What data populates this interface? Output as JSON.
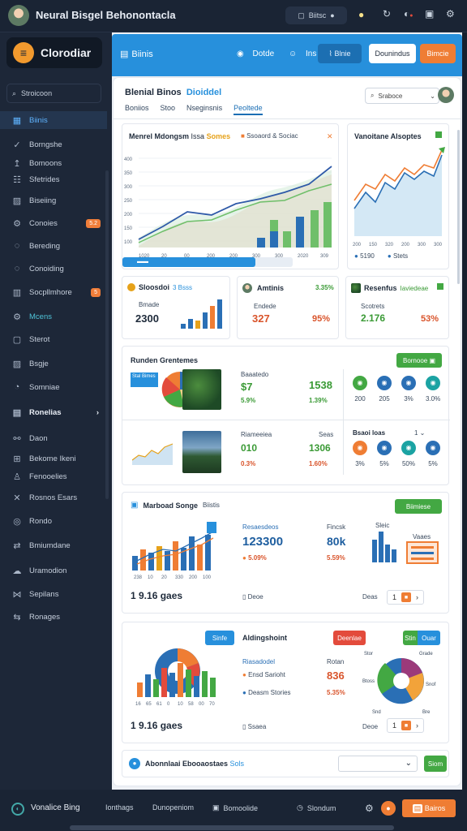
{
  "topbar": {
    "title": "Neural Bisgel Behonontacla",
    "button_label": "Biitsc"
  },
  "sidebar": {
    "brand": "Clorodiar",
    "search_placeholder": "Stroicoon",
    "items": [
      {
        "label": "Biinis",
        "icon": "grid-icon"
      },
      {
        "label": "Borngshe",
        "icon": "check-icon"
      },
      {
        "label": "Bomoons",
        "icon": "arrow-up-icon"
      },
      {
        "label": "Sfetrides",
        "icon": "sliders-icon"
      },
      {
        "label": "Biseiing",
        "icon": "image-icon"
      },
      {
        "label": "Conoies",
        "icon": "gear-icon",
        "badge": "5.2"
      },
      {
        "label": "Bereding",
        "icon": "chat-icon"
      },
      {
        "label": "Conoiding",
        "icon": "chat-icon"
      },
      {
        "label": "Socpllmhore",
        "icon": "bars-icon",
        "badge": "5"
      },
      {
        "label": "Mcens",
        "icon": "gear-icon"
      },
      {
        "label": "Sterot",
        "icon": "window-icon"
      },
      {
        "label": "Bsgje",
        "icon": "image-icon"
      },
      {
        "label": "Somniae",
        "icon": "pie-icon"
      }
    ],
    "section_label": "Ronelias",
    "section_items": [
      {
        "label": "Daon",
        "icon": "link-icon"
      },
      {
        "label": "Bekome Ikeni",
        "icon": "cart-icon"
      },
      {
        "label": "Fenooelies",
        "icon": "user-icon"
      },
      {
        "label": "Rosnos Esars",
        "icon": "tool-icon"
      },
      {
        "label": "Rondo",
        "icon": "target-icon"
      },
      {
        "label": "Bmiumdane",
        "icon": "route-icon"
      },
      {
        "label": "Uramodion",
        "icon": "cloud-icon"
      },
      {
        "label": "Sepilans",
        "icon": "handshake-icon"
      },
      {
        "label": "Ronages",
        "icon": "arrows-icon"
      }
    ]
  },
  "header": {
    "title": "Biinis",
    "nav": [
      {
        "label": "Dotde",
        "icon": "palette-icon"
      },
      {
        "label": "Ins",
        "icon": "smile-icon"
      },
      {
        "label": "Blnie",
        "icon": "chart-icon"
      }
    ],
    "btn_white": "Dounindus",
    "btn_orange": "Bimcie"
  },
  "toolbar": {
    "heading": "Blenial Binos",
    "heading_accent": "Dioiddel",
    "tabs": [
      "Boniios",
      "Stoo",
      "Nseginsnis",
      "Peoltede"
    ],
    "active_tab": 3,
    "search_placeholder": "Sraboce"
  },
  "main_chart": {
    "title": "Menrel Mdongsm",
    "meta": "Issa",
    "legend": "Somes",
    "legend2": "Ssoaord & Sociac",
    "y_ticks": [
      "400",
      "350",
      "300",
      "250",
      "200",
      "150",
      "100"
    ],
    "x_ticks": [
      "1020",
      "20",
      "00",
      "200",
      "200",
      "300",
      "300",
      "2020",
      "309"
    ],
    "progress": 0.78
  },
  "side_chart": {
    "title": "Vanoitane Alsoptes",
    "x_ticks": [
      "200",
      "150",
      "320",
      "200",
      "300",
      "300"
    ],
    "legend": [
      {
        "label": "5190"
      },
      {
        "label": "Stets"
      }
    ]
  },
  "kpis": [
    {
      "title": "Sloosdoi",
      "meta": "3 Bsss",
      "sub": "Bmade",
      "value": "2300"
    },
    {
      "title": "Amtinis",
      "change": "3.35%",
      "sub": "Endede",
      "value": "327",
      "value2": "95%"
    },
    {
      "title": "Resenfus",
      "meta": "Iaviedeae",
      "sub": "Scotrets",
      "value": "2.176",
      "value2": "53%"
    }
  ],
  "resource_panel": {
    "title": "Runden Grentemes",
    "btn": "Bornooe",
    "block1": {
      "label": "Baaatedo",
      "value": "$7",
      "change": "5.9%",
      "big": "1538",
      "big_change": "1.39%"
    },
    "block2": {
      "label": "Riameeiea",
      "meta": "Seas",
      "value": "010",
      "change": "0.3%",
      "big": "1306",
      "big_change": "1.60%"
    },
    "pie_tag": "Stal Bimes",
    "circles_top": [
      "200",
      "205",
      "3%",
      "3.0%"
    ],
    "circles_label": "Bsaoi loas",
    "circles_bottom": [
      "3%",
      "5%",
      "50%",
      "5%"
    ]
  },
  "monitor_panel": {
    "title": "Marboad Songe",
    "meta": "Biistis",
    "btn": "Biimiese",
    "label1": "Resaesdeos",
    "value1": "123300",
    "change1": "5.09%",
    "label2": "Fincsk",
    "value2": "80k",
    "change2": "5.59%",
    "bar_label": "Sleic",
    "card_label": "Vaaes",
    "x_ticks": [
      "238",
      "10",
      "20",
      "330",
      "200",
      "100"
    ],
    "footer_big": "1 9.16 gaes",
    "footer_small": "Deoe",
    "pager_label": "Deas",
    "page": "1"
  },
  "analysis_panel": {
    "title": "Aldingshoint",
    "btn_blue": "Sinfe",
    "btn_red": "Deenlae",
    "btn_dual": [
      "Stin",
      "Ouar"
    ],
    "label1": "Riasadodel",
    "row1": "Ensd Sarioht",
    "row2": "Deasm Stories",
    "label2": "Rotan",
    "value1": "836",
    "value2": "5.35%",
    "x_ticks": [
      "16",
      "65",
      "61",
      "0",
      "10",
      "58",
      "00",
      "70"
    ],
    "pie_labels": [
      "Stor",
      "Grade",
      "Btoss",
      "Snof",
      "Snd",
      "Bre"
    ],
    "footer_big": "1 9.16 gaes",
    "footer_small": "Ssaea",
    "pager_label": "Deoe",
    "page": "1"
  },
  "bottom_strip": {
    "label": "Abonnlaai Ebooaostaes",
    "meta": "Sols",
    "btn": "Siom"
  },
  "footer": {
    "brand": "Vonalice Bing",
    "items": [
      "Ionthags",
      "Dunopeniom",
      "Bomoolide",
      "Slondum"
    ],
    "btn": "Bairos"
  },
  "colors": {
    "primary": "#2790dc",
    "orange": "#ef7d34",
    "green": "#43a843",
    "red": "#e34b3c",
    "sidebar": "#1d2738"
  }
}
